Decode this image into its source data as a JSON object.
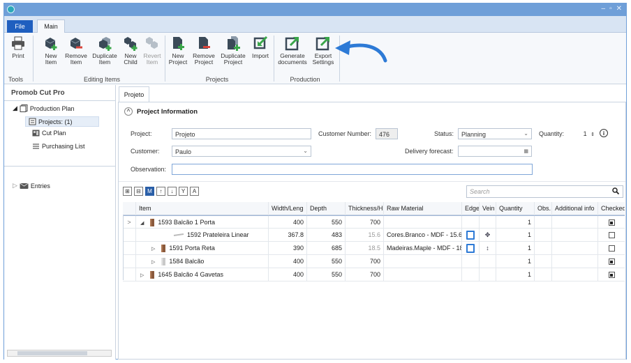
{
  "window": {
    "controls": [
      "–",
      "▫",
      "✕"
    ]
  },
  "ribbon": {
    "tabs": {
      "file": "File",
      "main": "Main"
    },
    "groups": {
      "tools": "Tools",
      "editing_items": "Editing Items",
      "projects": "Projects",
      "production": "Production"
    },
    "buttons": {
      "print": "Print",
      "new_item": [
        "New",
        "Item"
      ],
      "remove_item": [
        "Remove",
        "Item"
      ],
      "duplicate_item": [
        "Duplicate",
        "Item"
      ],
      "new_child": [
        "New",
        "Child"
      ],
      "revert_item": [
        "Revert",
        "Item"
      ],
      "new_project": [
        "New",
        "Project"
      ],
      "remove_project": [
        "Remove",
        "Project"
      ],
      "duplicate_project": [
        "Duplicate",
        "Project"
      ],
      "import": "Import",
      "generate_documents": [
        "Generate",
        "documents"
      ],
      "export_settings": [
        "Export",
        "Settings"
      ]
    },
    "colors": {
      "accent": "#1f5fbf",
      "green": "#3aa64a",
      "red": "#d9453b",
      "arrow": "#2d7ad6"
    }
  },
  "sidebar": {
    "title": "Promob Cut Pro",
    "tree": {
      "production_plan": "Production Plan",
      "projects": "Projects: (1)",
      "cut_plan": "Cut Plan",
      "purchasing_list": "Purchasing List",
      "entries": "Entries"
    }
  },
  "doc_tab": "Projeto",
  "info": {
    "section_title": "Project Information",
    "project_label": "Project:",
    "project_value": "Projeto",
    "customer_number_label": "Customer Number:",
    "customer_number_value": "476",
    "status_label": "Status:",
    "status_value": "Planning",
    "quantity_label": "Quantity:",
    "quantity_value": "1",
    "customer_label": "Customer:",
    "customer_value": "Paulo",
    "delivery_label": "Delivery forecast:",
    "delivery_value": "",
    "observation_label": "Observation:",
    "observation_value": ""
  },
  "grid": {
    "search_placeholder": "Search",
    "toolbar": [
      "⊞",
      "⊟",
      "M",
      "↑",
      "↓",
      "Y",
      "A"
    ],
    "columns": [
      "Item",
      "Width/Leng",
      "Depth",
      "Thickness/H",
      "Raw Material",
      "Edge",
      "Vein",
      "Quantity",
      "Obs.",
      "Additional info",
      "Checked"
    ],
    "rows": [
      {
        "expander": "◢",
        "pointer": ">",
        "name": "1593 Balcão 1 Porta",
        "width": "400",
        "depth": "550",
        "thickness": "700",
        "material": "",
        "edge": false,
        "vein": "",
        "qty": "1",
        "checked": true,
        "indent": 0
      },
      {
        "expander": "",
        "pointer": "",
        "name": "1592 Prateleira Linear",
        "width": "367.8",
        "depth": "483",
        "thickness": "15.6",
        "material": "Cores.Branco - MDF - 15.6",
        "edge": true,
        "vein": "✥",
        "qty": "1",
        "checked": false,
        "indent": 2
      },
      {
        "expander": "▷",
        "pointer": "",
        "name": "1591 Porta Reta",
        "width": "390",
        "depth": "685",
        "thickness": "18.5",
        "material": "Madeiras.Maple - MDF - 18",
        "edge": true,
        "vein": "↕",
        "qty": "1",
        "checked": false,
        "indent": 1
      },
      {
        "expander": "▷",
        "pointer": "",
        "name": "1584 Balcão",
        "width": "400",
        "depth": "550",
        "thickness": "700",
        "material": "",
        "edge": false,
        "vein": "",
        "qty": "1",
        "checked": true,
        "indent": 1
      },
      {
        "expander": "▷",
        "pointer": "",
        "name": "1645 Balcão 4 Gavetas",
        "width": "400",
        "depth": "550",
        "thickness": "700",
        "material": "",
        "edge": false,
        "vein": "",
        "qty": "1",
        "checked": true,
        "indent": 0
      }
    ]
  }
}
